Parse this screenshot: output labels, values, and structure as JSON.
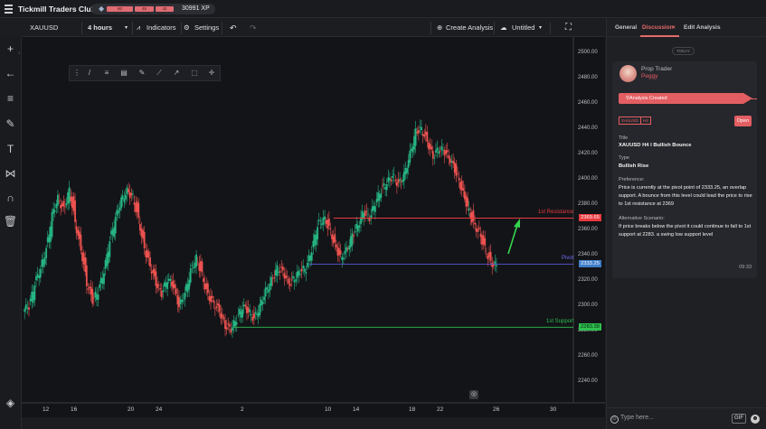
{
  "app": {
    "title": "Tickmill Traders Club",
    "xp_pills": [
      "60",
      "45",
      "42"
    ],
    "xp": "30991 XP"
  },
  "toolbar": {
    "symbol": "XAUUSD",
    "timeframe": "4 hours",
    "indicators_label": "Indicators",
    "settings_label": "Settings",
    "create_label": "Create Analysis",
    "untitled_label": "Untitled"
  },
  "chart_data": {
    "type": "candlestick",
    "symbol": "XAUUSD",
    "timeframe": "H4",
    "ylim": [
      2230,
      2510
    ],
    "y_ticks": [
      "2500.00",
      "2480.00",
      "2460.00",
      "2440.00",
      "2420.00",
      "2400.00",
      "2380.00",
      "2360.00",
      "2340.00",
      "2320.00",
      "2300.00",
      "2280.00",
      "2260.00",
      "2240.00"
    ],
    "x_ticks": [
      "12",
      "16",
      "20",
      "24",
      "2",
      "10",
      "14",
      "18",
      "22",
      "26",
      "30"
    ],
    "levels": [
      {
        "name": "1st Resistance",
        "price_label": "2369.65",
        "color": "#e8393f"
      },
      {
        "name": "Pivot",
        "price_label": "2333.25",
        "color": "#5a56d8"
      },
      {
        "name": "1st Support",
        "price_label": "2283.38",
        "color": "#2fbf4f"
      }
    ],
    "current_price": "2332.00",
    "levels_values": [
      2369.65,
      2333.25,
      2283.38
    ],
    "closes": [
      2300,
      2318,
      2330,
      2345,
      2372,
      2385,
      2376,
      2392,
      2366,
      2345,
      2318,
      2305,
      2312,
      2328,
      2352,
      2370,
      2384,
      2391,
      2386,
      2368,
      2345,
      2332,
      2318,
      2310,
      2322,
      2316,
      2300,
      2310,
      2328,
      2338,
      2324,
      2308,
      2302,
      2296,
      2284,
      2282,
      2290,
      2300,
      2296,
      2290,
      2300,
      2312,
      2320,
      2330,
      2327,
      2318,
      2322,
      2328,
      2330,
      2345,
      2364,
      2370,
      2362,
      2348,
      2338,
      2344,
      2356,
      2364,
      2375,
      2370,
      2382,
      2392,
      2398,
      2403,
      2396,
      2404,
      2420,
      2438,
      2440,
      2430,
      2418,
      2425,
      2422,
      2416,
      2405,
      2392,
      2378,
      2365,
      2358,
      2345,
      2334,
      2332
    ]
  },
  "right_panel": {
    "tabs": [
      "General",
      "Discussion",
      "Edit Analysis"
    ],
    "today": "TODAY",
    "author_role": "Prop Trader",
    "author_name": "Peggy",
    "banner": "Analysis Created",
    "tag_symbol": "XAUUSD",
    "tag_tf": "H4",
    "open_label": "Open",
    "title_key": "Title",
    "title_value": "XAUUSD H4 I Bullish Bounce",
    "type_key": "Type",
    "type_value": "Bullish Rise",
    "pref_key": "Preference:",
    "pref_text": "Price is currently at the pivot point of 2333.25, an overlap support. A bounce from this level could lead the price to rise to 1st resistance at 2369",
    "alt_key": "Alternative Scenario:",
    "alt_text": "If price breaks below the pivot it could continue to fall to 1st support at 2283. a swing low support level",
    "time": "09:33",
    "input_placeholder": "Type here...",
    "gif_label": "GIF"
  }
}
